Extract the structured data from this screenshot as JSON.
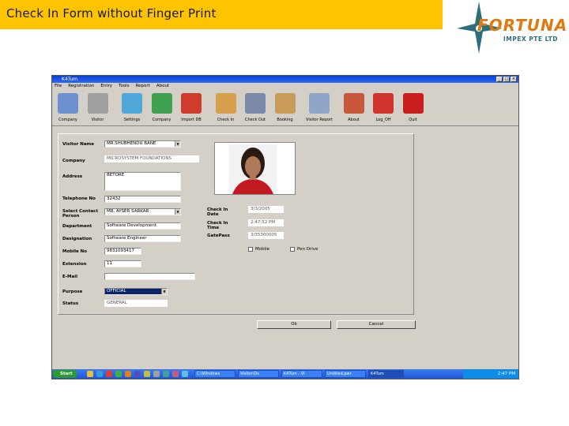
{
  "slide": {
    "title": "Check In Form without Finger Print",
    "logo_name": "FORTUNA",
    "logo_sub": "IMPEX PTE LTD",
    "accent_color": "#ffc400"
  },
  "window": {
    "title": "K4Tum",
    "menu": [
      "File",
      "Registration",
      "Entry",
      "Tools",
      "Report",
      "About"
    ]
  },
  "toolbar": [
    {
      "label": "Company",
      "icon": "company-icon",
      "color": "#6b8fcf"
    },
    {
      "label": "Visitor",
      "icon": "visitor-icon",
      "color": "#a0a0a0"
    },
    {
      "label": "Settings",
      "icon": "settings-icon",
      "color": "#4fa8d8"
    },
    {
      "label": "Company",
      "icon": "globe-icon",
      "color": "#3fa04f"
    },
    {
      "label": "Import DB",
      "icon": "import-db-icon",
      "color": "#d03c2c"
    },
    {
      "label": "Check In",
      "icon": "check-in-icon",
      "color": "#d6a04c"
    },
    {
      "label": "Check Out",
      "icon": "check-out-icon",
      "color": "#7a8aa8"
    },
    {
      "label": "Booking",
      "icon": "booking-icon",
      "color": "#c89c58"
    },
    {
      "label": "Visitor Report",
      "icon": "report-icon",
      "color": "#8fa6c8"
    },
    {
      "label": "About",
      "icon": "about-icon",
      "color": "#c8583c"
    },
    {
      "label": "Log_Off",
      "icon": "log-off-icon",
      "color": "#d0342c"
    },
    {
      "label": "Quit",
      "icon": "stop-icon",
      "color": "#c81e1e"
    }
  ],
  "form": {
    "visitor_name_label": "Visitor Name",
    "visitor_name": "MR.SHUBHENDU BANE",
    "company_label": "Company",
    "company": "MICROSYSTEM FOUNDATIONS",
    "address_label": "Address",
    "address": "BETORE",
    "telephone_label": "Telephone No",
    "telephone": "32432",
    "contact_label": "Select Contact Person",
    "contact": "MR. AYSER SARKAR",
    "department_label": "Department",
    "department": "Software Development",
    "designation_label": "Designation",
    "designation": "Software Engineer",
    "mobile_label": "Mobile No",
    "mobile": "9831093417",
    "extension_label": "Extension",
    "extension": "11",
    "email_label": "E-Mail",
    "email": "",
    "purpose_label": "Purpose",
    "purpose": "OFFICIAL",
    "status_label": "Status",
    "status": "GENERAL",
    "check_in_date_label": "Check In Date",
    "check_in_date": "3/3/2005",
    "check_in_time_label": "Check In Time",
    "check_in_time": "2:47:52 PM",
    "gate_pass_label": "GatePass",
    "gate_pass": "3/35300005",
    "mobile_chk_label": "Mobile",
    "pen_drive_chk_label": "Pen Drive",
    "ok_label": "Ok",
    "cancel_label": "Cancel"
  },
  "taskbar": {
    "start_label": "Start",
    "tasks": [
      "C:\\Windows",
      "Visitor\\Ds",
      "K4Tum - Vi",
      "Untitled.pwr",
      "K4Tum"
    ],
    "clock": "2:47 PM"
  }
}
